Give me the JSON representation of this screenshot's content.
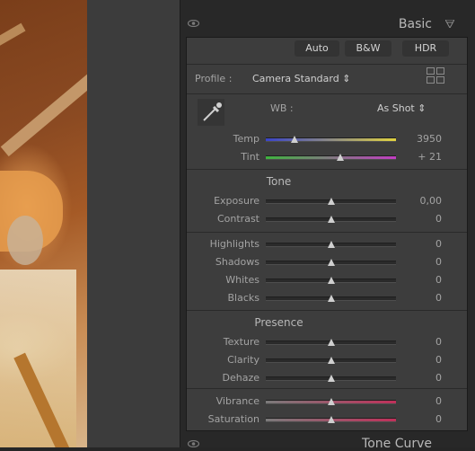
{
  "panel": {
    "title": "Basic"
  },
  "treatment": {
    "auto": "Auto",
    "bw": "B&W",
    "hdr": "HDR"
  },
  "profile": {
    "label": "Profile :",
    "value": "Camera Standard ⇕"
  },
  "wb": {
    "label": "WB :",
    "value": "As Shot ⇕"
  },
  "temp": {
    "label": "Temp",
    "value": "3950",
    "level": 0.22
  },
  "tint": {
    "label": "Tint",
    "value": "+ 21",
    "level": 0.57
  },
  "tone": {
    "title": "Tone",
    "exposure": {
      "label": "Exposure",
      "value": "0,00",
      "level": 0.5
    },
    "contrast": {
      "label": "Contrast",
      "value": "0",
      "level": 0.5
    },
    "highlights": {
      "label": "Highlights",
      "value": "0",
      "level": 0.5
    },
    "shadows": {
      "label": "Shadows",
      "value": "0",
      "level": 0.5
    },
    "whites": {
      "label": "Whites",
      "value": "0",
      "level": 0.5
    },
    "blacks": {
      "label": "Blacks",
      "value": "0",
      "level": 0.5
    }
  },
  "presence": {
    "title": "Presence",
    "texture": {
      "label": "Texture",
      "value": "0",
      "level": 0.5
    },
    "clarity": {
      "label": "Clarity",
      "value": "0",
      "level": 0.5
    },
    "dehaze": {
      "label": "Dehaze",
      "value": "0",
      "level": 0.5
    },
    "vibrance": {
      "label": "Vibrance",
      "value": "0",
      "level": 0.5
    },
    "saturation": {
      "label": "Saturation",
      "value": "0",
      "level": 0.5
    }
  },
  "next_panel": {
    "title": "Tone Curve"
  },
  "colors": {
    "temp_gradient": [
      "#3a44c8",
      "#e0d240"
    ],
    "tint_gradient": [
      "#3fb33f",
      "#c23ec2"
    ],
    "vibrance_gradient": [
      "#7a7a7a",
      "#c0305a"
    ]
  },
  "icons": [
    "eye-icon",
    "collapse-triangle-icon",
    "profile-grid-icon",
    "eyedropper-icon"
  ]
}
